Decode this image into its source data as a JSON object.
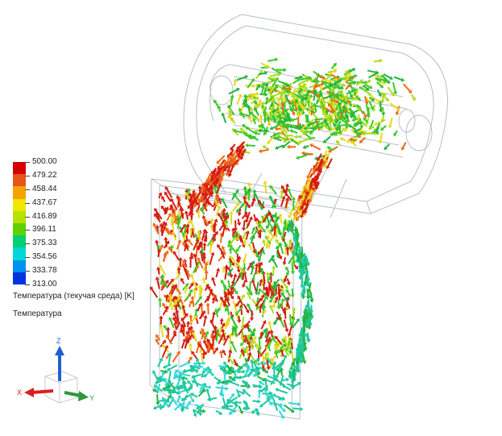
{
  "legend": {
    "title": "Температура (текучая среда) [K]",
    "ticks": [
      "500.00",
      "479.22",
      "458.44",
      "437.67",
      "416.89",
      "396.11",
      "375.33",
      "354.56",
      "333.78",
      "313.00"
    ],
    "colors": [
      "#d40000",
      "#e8541a",
      "#f5a300",
      "#f0e600",
      "#b8e000",
      "#5fd000",
      "#00d070",
      "#00d8d8",
      "#0090f0",
      "#0033e0"
    ]
  },
  "plot_name": "Температура",
  "triad": {
    "x": "X",
    "y": "Y",
    "z": "Z"
  }
}
